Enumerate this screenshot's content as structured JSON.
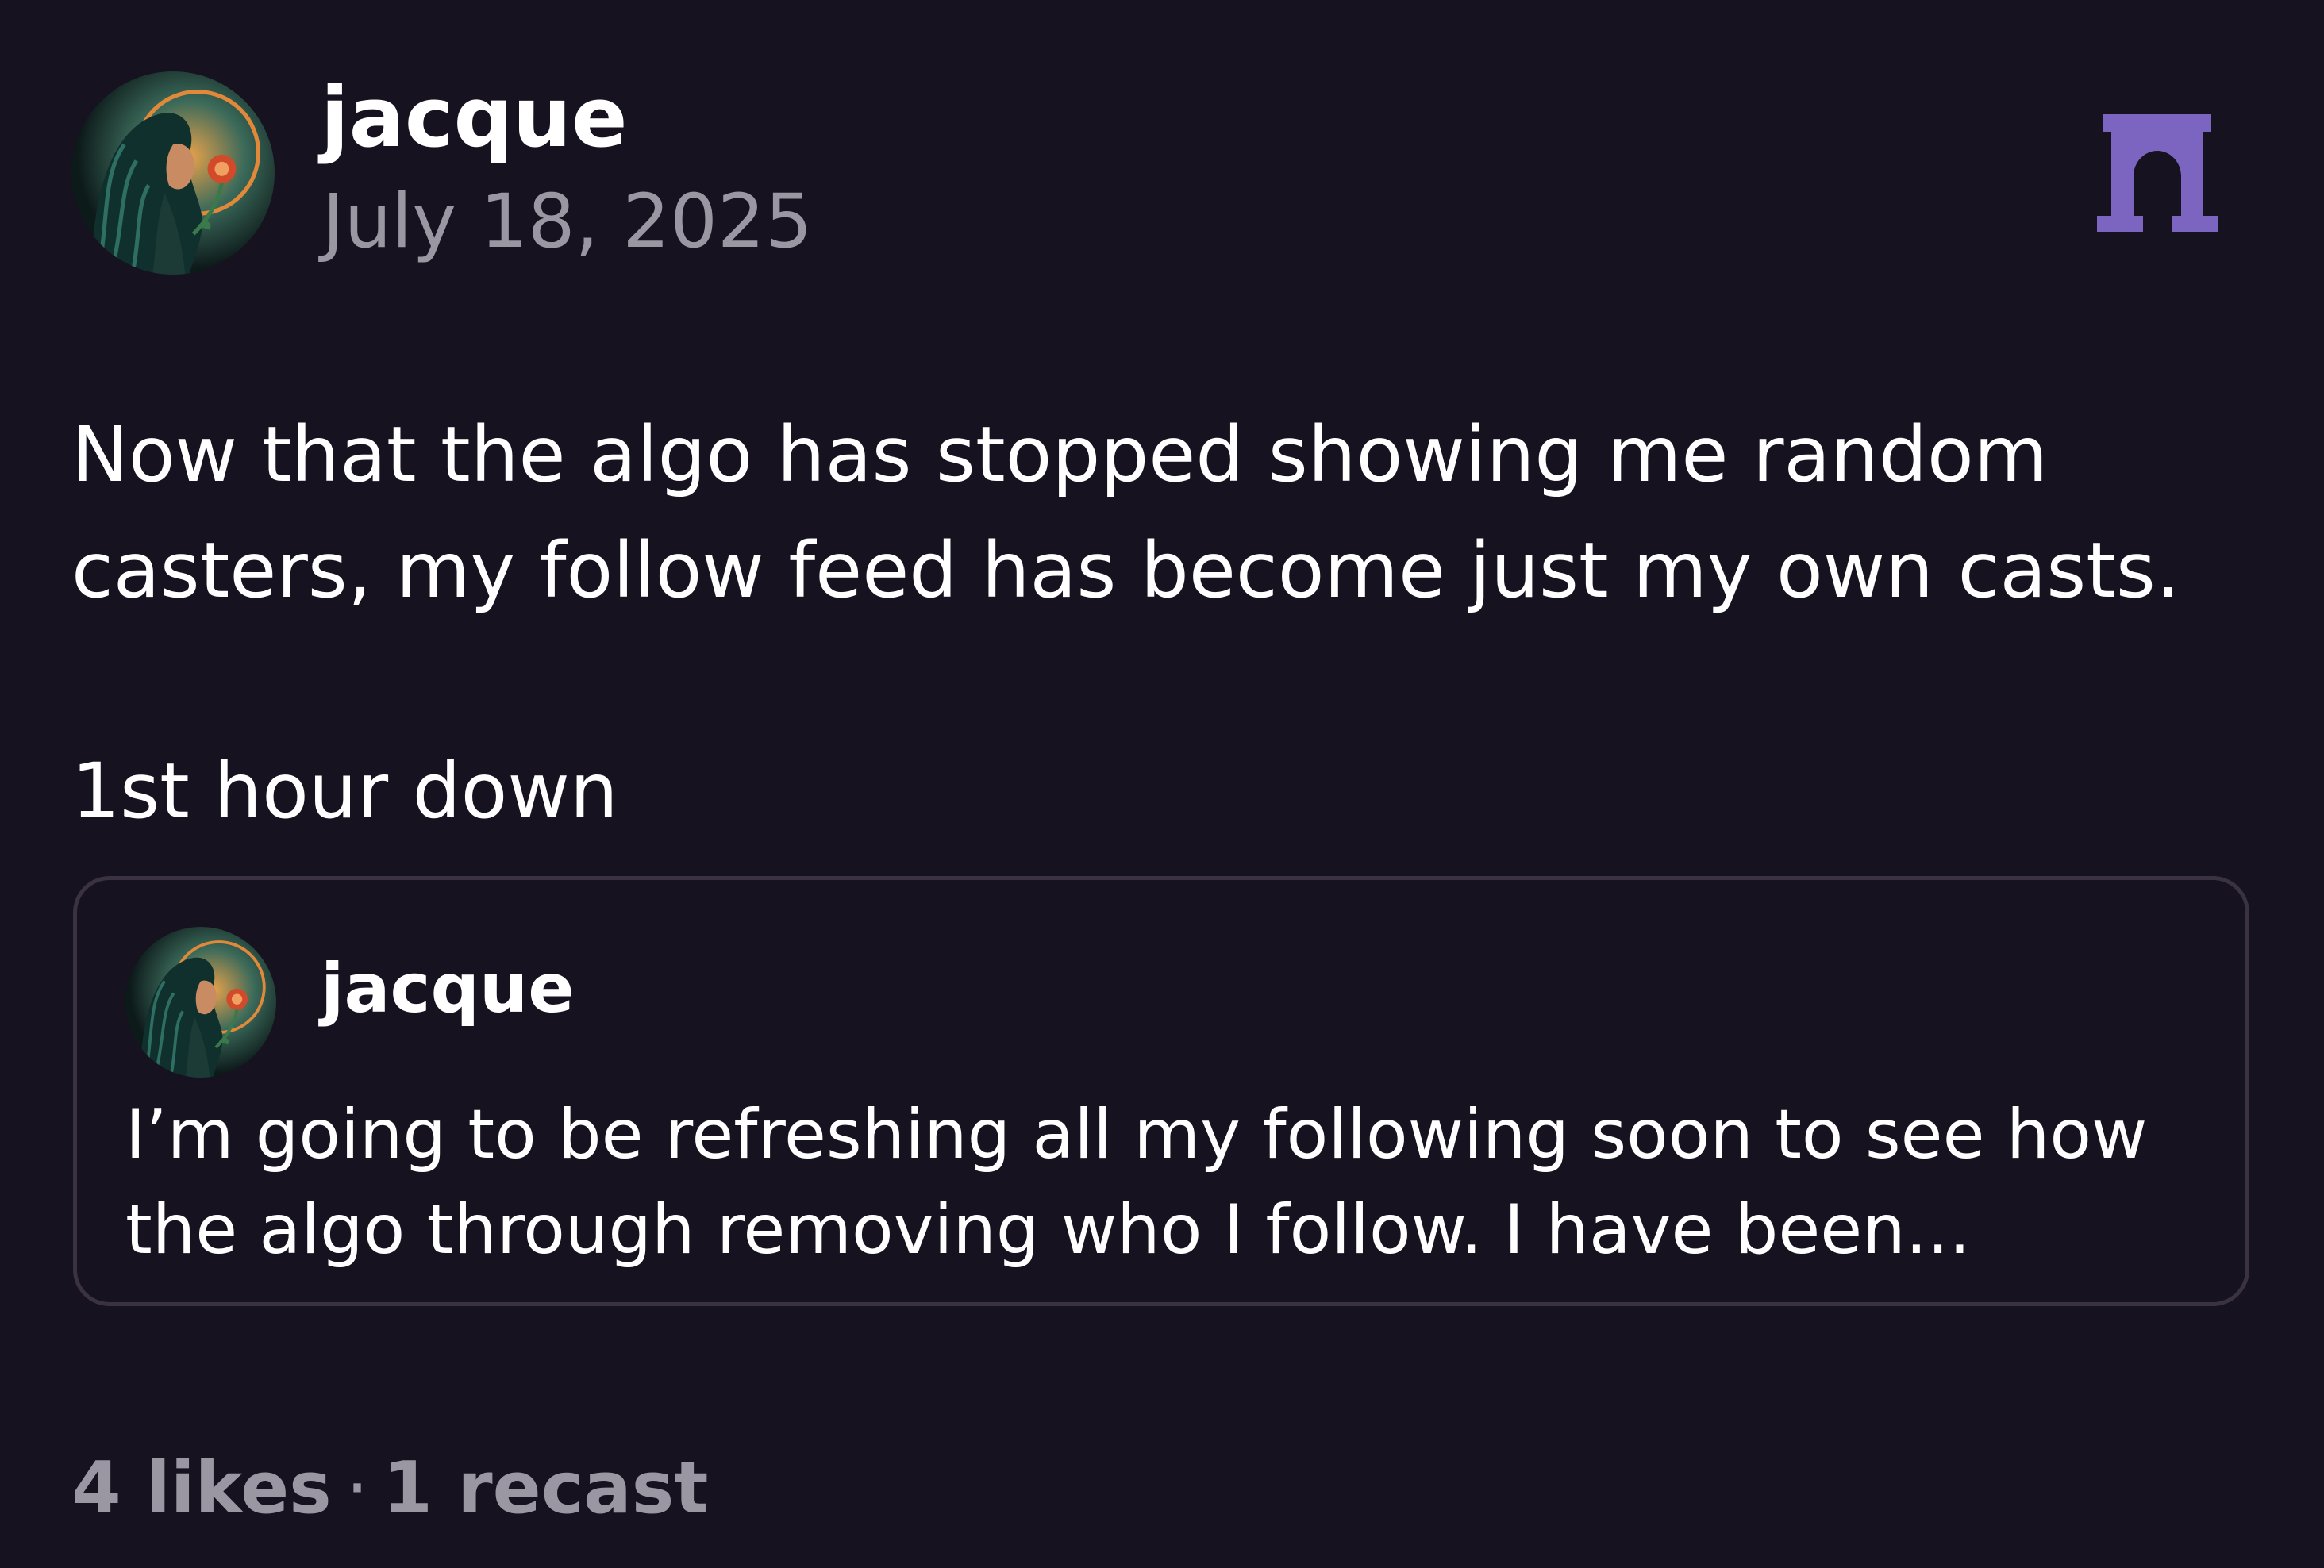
{
  "post": {
    "author": {
      "username": "jacque"
    },
    "timestamp": "July 18, 2025",
    "body": {
      "line1": "Now that the algo has stopped showing me random",
      "line2": "casters, my follow feed has become just my own casts.",
      "line3": "1st hour down"
    },
    "quoted_cast": {
      "author": {
        "username": "jacque"
      },
      "text_line1": "I’m going to be refreshing all my following soon to see how",
      "text_line2": "the algo through removing who I follow. I have been..."
    },
    "stats": {
      "likes": "4 likes",
      "separator": "·",
      "recasts": "1 recast"
    }
  },
  "icons": {
    "brand": "farcaster-arch-icon",
    "avatar": "avatar-illustration"
  },
  "colors": {
    "background": "#17121f",
    "text": "#ffffff",
    "muted": "#9a97a3",
    "border": "#3a3243",
    "brand": "#7c65c1"
  }
}
